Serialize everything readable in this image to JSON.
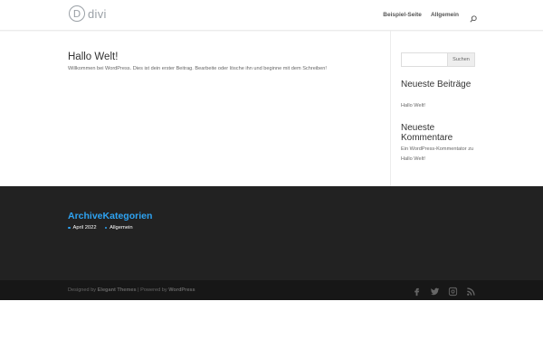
{
  "header": {
    "logo_mark": "D",
    "logo_text": "divi",
    "nav": [
      {
        "label": "Beispiel-Seite"
      },
      {
        "label": "Allgemein"
      }
    ]
  },
  "post": {
    "title": "Hallo Welt!",
    "excerpt": "Willkommen bei WordPress. Dies ist dein erster Beitrag. Bearbeite oder lösche ihn und beginne mit dem Schreiben!"
  },
  "sidebar": {
    "search_placeholder": "",
    "search_button": "Suchen",
    "recent_posts_title": "Neueste Beiträge",
    "recent_posts": [
      "Hallo Welt!"
    ],
    "recent_comments_title": "Neueste Kommentare",
    "recent_comments": [
      "Ein WordPress-Kommentator zu Hallo Welt!"
    ]
  },
  "footer": {
    "heading": "ArchiveKategorien",
    "links": [
      "April 2022",
      "Allgemein"
    ],
    "accent": "#2ea3f2",
    "credits": {
      "prefix": "Designed by ",
      "designer": "Elegant Themes",
      "separator": " | Powered by ",
      "platform": "WordPress"
    },
    "socials": [
      "facebook-icon",
      "twitter-icon",
      "instagram-icon",
      "rss-icon"
    ]
  },
  "colors": {
    "accent": "#2ea3f2",
    "footer_bg": "#222222",
    "bottom_bar_bg": "#171717"
  }
}
